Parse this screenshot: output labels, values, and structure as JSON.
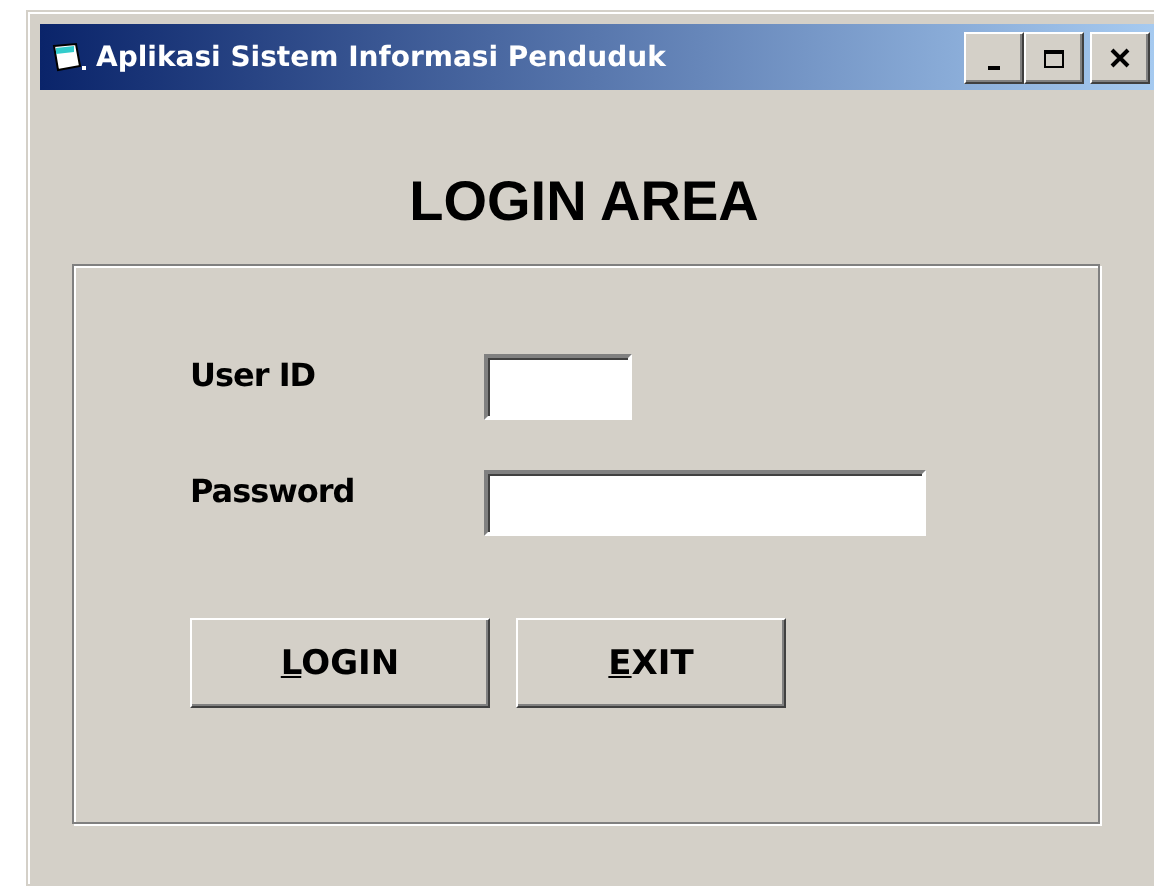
{
  "window": {
    "title": "Aplikasi Sistem Informasi Penduduk",
    "controls": [
      {
        "kind": "minimize"
      },
      {
        "kind": "maximize"
      },
      {
        "kind": "close"
      }
    ]
  },
  "heading": "LOGIN AREA",
  "fields": [
    {
      "label": "User ID"
    },
    {
      "label": "Password"
    }
  ],
  "buttons": [
    {
      "label": "LOGIN"
    },
    {
      "label": "EXIT"
    }
  ]
}
